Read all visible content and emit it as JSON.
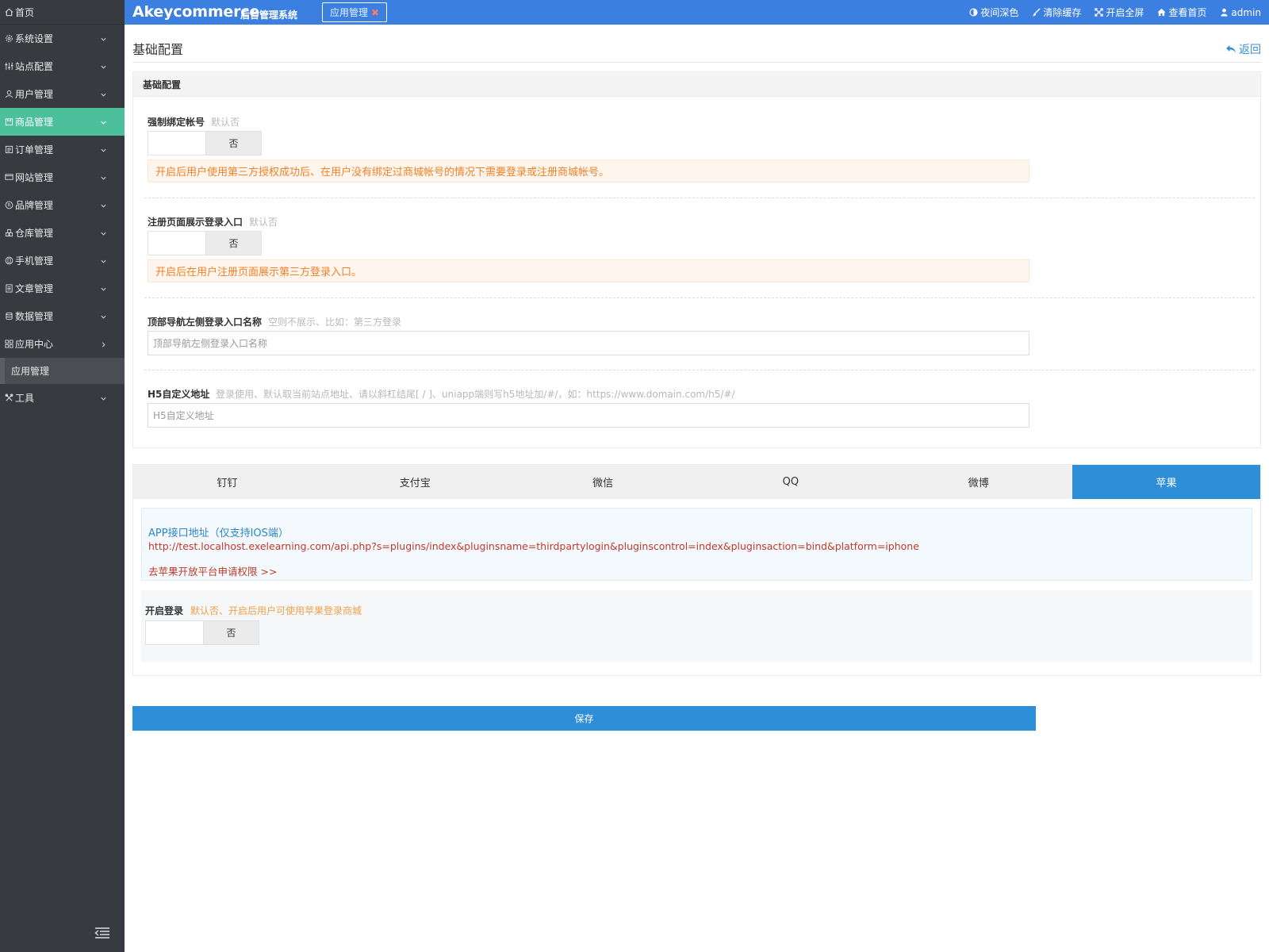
{
  "sidebar": {
    "home": "首页",
    "items": [
      {
        "label": "系统设置",
        "icon": "gear-icon"
      },
      {
        "label": "站点配置",
        "icon": "sliders-icon"
      },
      {
        "label": "用户管理",
        "icon": "user-icon"
      },
      {
        "label": "商品管理",
        "icon": "box-icon",
        "active": true
      },
      {
        "label": "订单管理",
        "icon": "list-icon"
      },
      {
        "label": "网站管理",
        "icon": "browser-icon"
      },
      {
        "label": "品牌管理",
        "icon": "registered-icon"
      },
      {
        "label": "仓库管理",
        "icon": "warehouse-icon"
      },
      {
        "label": "手机管理",
        "icon": "phone-icon"
      },
      {
        "label": "文章管理",
        "icon": "article-icon"
      },
      {
        "label": "数据管理",
        "icon": "database-icon"
      },
      {
        "label": "应用中心",
        "icon": "apps-icon"
      }
    ],
    "sub_item": "应用管理",
    "tools": "工具"
  },
  "topbar": {
    "brand": "Akeycommerce",
    "brand_sub": "后台管理系统",
    "open_tab": "应用管理",
    "actions": {
      "night": "夜间深色",
      "clear_cache": "清除缓存",
      "fullscreen": "开启全屏",
      "view_home": "查看首页",
      "user": "admin"
    },
    "color": "#3b7fe0"
  },
  "page": {
    "title": "基础配置",
    "back": "返回"
  },
  "panel": {
    "title": "基础配置",
    "force_bind": {
      "label": "强制绑定帐号",
      "tip": "默认否",
      "state": "否",
      "notice": "开启后用户使用第三方授权成功后、在用户没有绑定过商城帐号的情况下需要登录或注册商城帐号。"
    },
    "register_show": {
      "label": "注册页面展示登录入口",
      "tip": "默认否",
      "state": "否",
      "notice": "开启后在用户注册页面展示第三方登录入口。"
    },
    "nav_name": {
      "label": "顶部导航左侧登录入口名称",
      "tip": "空则不展示、比如：第三方登录",
      "placeholder": "顶部导航左侧登录入口名称",
      "value": ""
    },
    "h5_url": {
      "label": "H5自定义地址",
      "tip": "登录使用、默认取当前站点地址、请以斜杠结尾[ / ]、uniapp端则写h5地址加/#/，如：https://www.domain.com/h5/#/",
      "placeholder": "H5自定义地址",
      "value": ""
    }
  },
  "tabs": {
    "items": [
      "钉钉",
      "支付宝",
      "微信",
      "QQ",
      "微博",
      "苹果"
    ],
    "active_index": 5,
    "info_title": "APP接口地址（仅支持IOS端）",
    "info_url": "http://test.localhost.exelearning.com/api.php?s=plugins/index&pluginsname=thirdpartylogin&pluginscontrol=index&pluginsaction=bind&platform=iphone",
    "info_link": "去苹果开放平台申请权限 >>",
    "login_label": "开启登录",
    "login_tip": "默认否、开启后用户可使用苹果登录商城",
    "login_state": "否"
  },
  "save": "保存"
}
